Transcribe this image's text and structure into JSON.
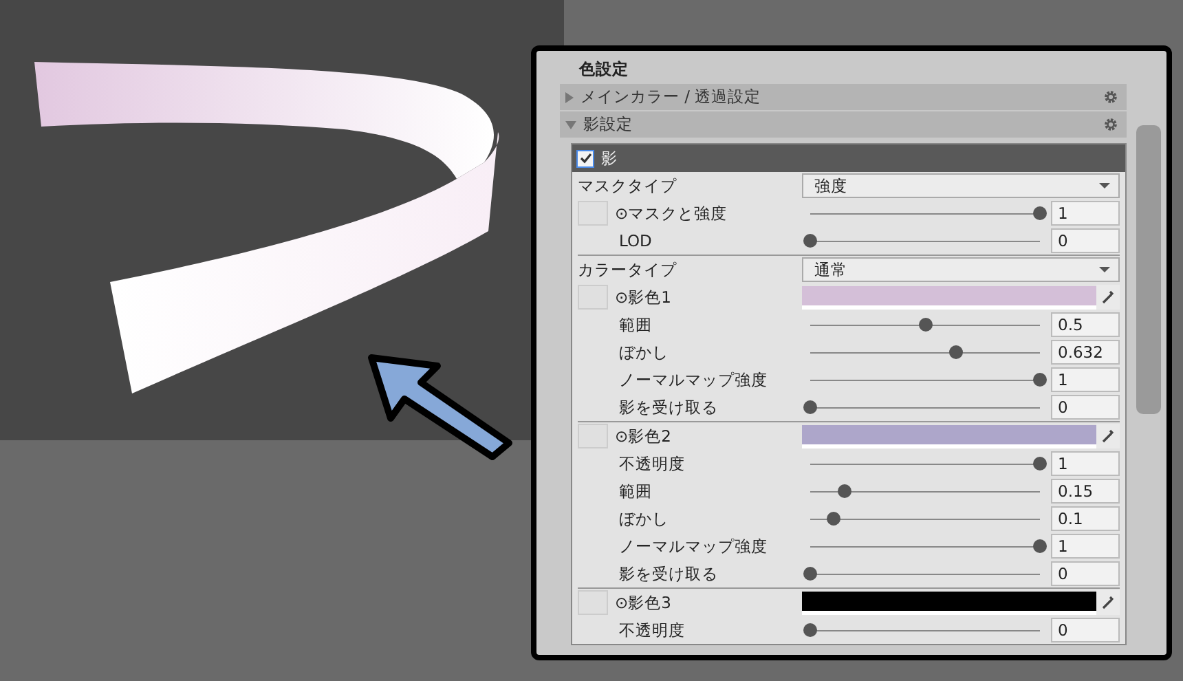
{
  "section_title": "色設定",
  "foldouts": [
    {
      "label": "メインカラー / 透過設定",
      "expanded": false
    },
    {
      "label": "影設定",
      "expanded": true
    }
  ],
  "shadow": {
    "label": "影",
    "checked": true,
    "groups": [
      [
        {
          "kind": "dropdown",
          "label": "マスクタイプ",
          "value": "強度"
        },
        {
          "kind": "box-slider",
          "label": "⊙マスクと強度",
          "level": 1,
          "value": "1"
        },
        {
          "kind": "slider",
          "label": "LOD",
          "level": 0,
          "value": "0"
        }
      ],
      [
        {
          "kind": "dropdown",
          "label": "カラータイプ",
          "value": "通常"
        },
        {
          "kind": "box-color",
          "label": "⊙影色1",
          "color": "#d4bfd8"
        },
        {
          "kind": "slider",
          "label": "範囲",
          "level": 0.5,
          "value": "0.5"
        },
        {
          "kind": "slider",
          "label": "ぼかし",
          "level": 0.632,
          "value": "0.632"
        },
        {
          "kind": "slider",
          "label": "ノーマルマップ強度",
          "level": 1,
          "value": "1"
        },
        {
          "kind": "slider",
          "label": "影を受け取る",
          "level": 0,
          "value": "0"
        }
      ],
      [
        {
          "kind": "box-color",
          "label": "⊙影色2",
          "color": "#ada6ca"
        },
        {
          "kind": "slider",
          "label": "不透明度",
          "level": 1,
          "value": "1"
        },
        {
          "kind": "slider",
          "label": "範囲",
          "level": 0.15,
          "value": "0.15"
        },
        {
          "kind": "slider",
          "label": "ぼかし",
          "level": 0.1,
          "value": "0.1"
        },
        {
          "kind": "slider",
          "label": "ノーマルマップ強度",
          "level": 1,
          "value": "1"
        },
        {
          "kind": "slider",
          "label": "影を受け取る",
          "level": 0,
          "value": "0"
        }
      ],
      [
        {
          "kind": "box-color",
          "label": "⊙影色3",
          "color": "#000000"
        },
        {
          "kind": "slider",
          "label": "不透明度",
          "level": 0,
          "value": "0"
        }
      ]
    ]
  }
}
